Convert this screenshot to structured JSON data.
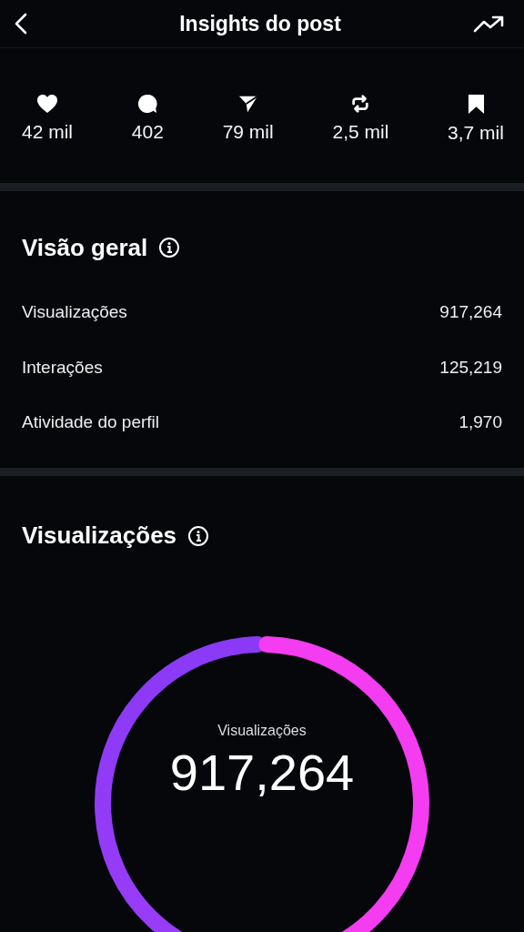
{
  "header": {
    "title": "Insights do post"
  },
  "stats": [
    {
      "kind": "like",
      "value": "42 mil"
    },
    {
      "kind": "comment",
      "value": "402"
    },
    {
      "kind": "share",
      "value": "79 mil"
    },
    {
      "kind": "repost",
      "value": "2,5 mil"
    },
    {
      "kind": "save",
      "value": "3,7 mil"
    }
  ],
  "overview": {
    "title": "Visão geral",
    "rows": [
      {
        "label": "Visualizações",
        "value": "917,264"
      },
      {
        "label": "Interações",
        "value": "125,219"
      },
      {
        "label": "Atividade do perfil",
        "value": "1,970"
      }
    ]
  },
  "views": {
    "title": "Visualizações",
    "center_label": "Visualizações",
    "center_value": "917,264"
  }
}
